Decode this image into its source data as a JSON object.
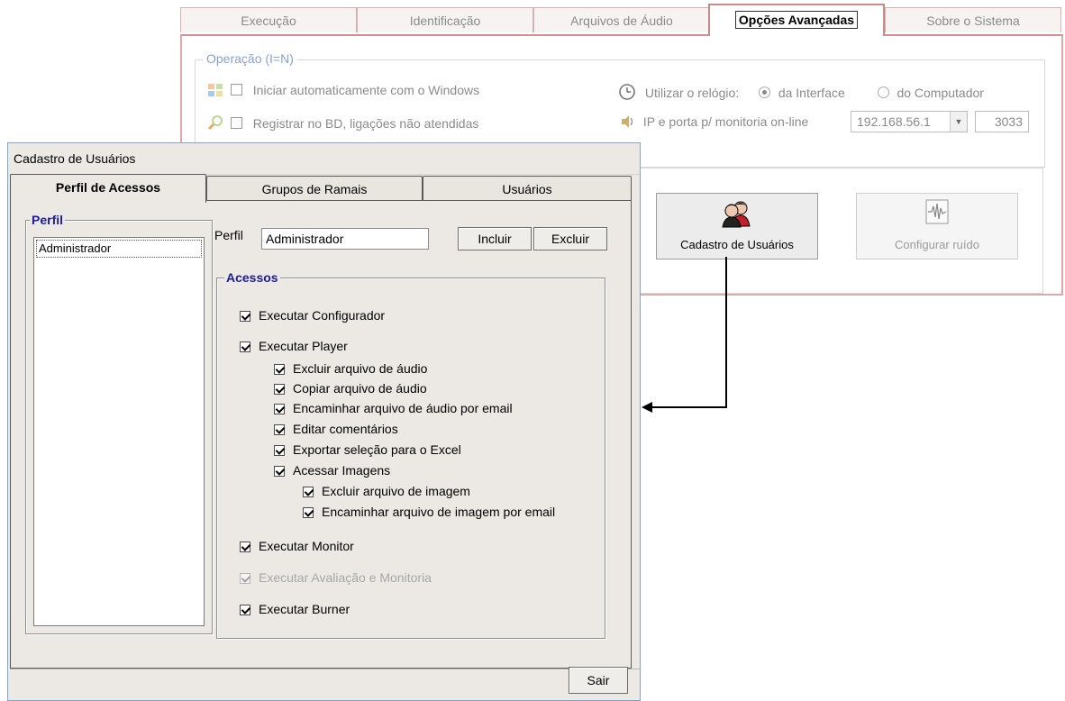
{
  "background_window": {
    "tabs": [
      {
        "label": "Execução",
        "active": false
      },
      {
        "label": "Identificação",
        "active": false
      },
      {
        "label": "Arquivos de Áudio",
        "active": false
      },
      {
        "label": "Opções Avançadas",
        "active": true
      },
      {
        "label": "Sobre o Sistema",
        "active": false
      }
    ],
    "operation_group": {
      "legend": "Operação (I=N)",
      "start_with_windows": "Iniciar automaticamente com o Windows",
      "register_db": "Registrar no BD, ligações não atendidas",
      "clock_label": "Utilizar o relógio:",
      "clock_options": [
        "da Interface",
        "do Computador"
      ],
      "clock_selected": "da Interface",
      "ip_label": "IP e porta p/ monitoria on-line",
      "ip_value": "192.168.56.1",
      "port_value": "3033"
    },
    "buttons": {
      "cadastro": "Cadastro de Usuários",
      "ruido": "Configurar ruído"
    }
  },
  "dialog": {
    "title": "Cadastro de Usuários",
    "tabs": [
      {
        "label": "Perfil de Acessos",
        "active": true
      },
      {
        "label": "Grupos de Ramais",
        "active": false
      },
      {
        "label": "Usuários",
        "active": false
      }
    ],
    "perfil_group": {
      "legend": "Perfil",
      "items": [
        "Administrador"
      ]
    },
    "perfil_label": "Perfil",
    "perfil_value": "Administrador",
    "incluir": "Incluir",
    "excluir": "Excluir",
    "acessos": {
      "legend": "Acessos",
      "executar_configurador": "Executar Configurador",
      "executar_player": "Executar Player",
      "excluir_audio": "Excluir arquivo de áudio",
      "copiar_audio": "Copiar arquivo de áudio",
      "encaminhar_audio": "Encaminhar arquivo de áudio por email",
      "editar_comentarios": "Editar comentários",
      "exportar_excel": "Exportar seleção para o Excel",
      "acessar_imagens": "Acessar Imagens",
      "excluir_imagem": "Excluir arquivo de imagem",
      "encaminhar_imagem": "Encaminhar arquivo de imagem por email",
      "executar_monitor": "Executar Monitor",
      "executar_avaliacao": "Executar Avaliação e Monitoria",
      "executar_burner": "Executar Burner"
    },
    "sair": "Sair"
  },
  "colors": {
    "active_tab_border": "#c98a8a",
    "legend_blue": "#1c1c9c",
    "dialog_bg": "#ece9e4"
  }
}
